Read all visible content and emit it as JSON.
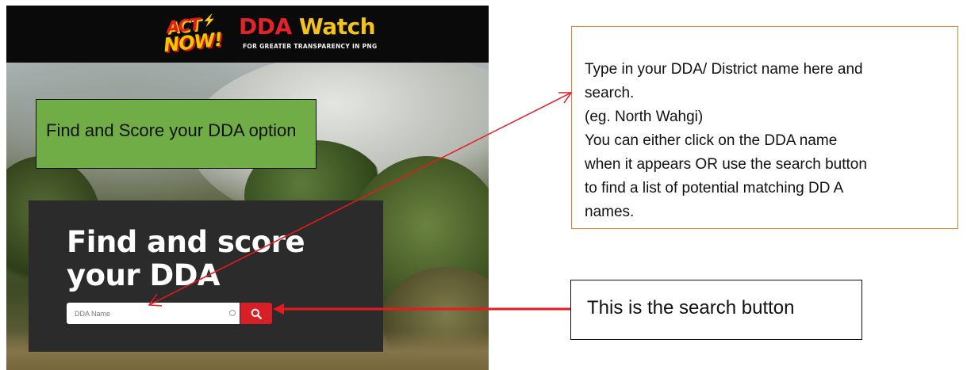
{
  "header": {
    "logo_act": "ACT",
    "logo_now": "NOW!",
    "brand_dda": "DDA",
    "brand_watch": "Watch",
    "tagline": "FOR GREATER TRANSPARENCY IN PNG"
  },
  "green_callout": {
    "text": "Find and Score your DDA option"
  },
  "search_panel": {
    "heading_line1": "Find and score",
    "heading_line2": "your DDA",
    "input_placeholder": "DDA Name",
    "search_icon": "search-icon"
  },
  "instruction_callout": {
    "lines": [
      "Type in your DDA/ District name  here and",
      "search.",
      "(eg. North Wahgi)",
      "You can either click on the DDA name",
      "when it appears OR use the search button",
      "to find a list of potential matching DD A",
      "names."
    ]
  },
  "button_callout": {
    "text": "This is the search button"
  },
  "colors": {
    "header_bg": "#0a0a0a",
    "brand_red": "#e3232a",
    "brand_yellow": "#f4c21a",
    "panel_bg": "#2b2b2b",
    "search_button": "#d61f26",
    "green_callout": "#70ad47",
    "orange_border": "#ed7d31",
    "arrow_red": "#e8191f"
  }
}
